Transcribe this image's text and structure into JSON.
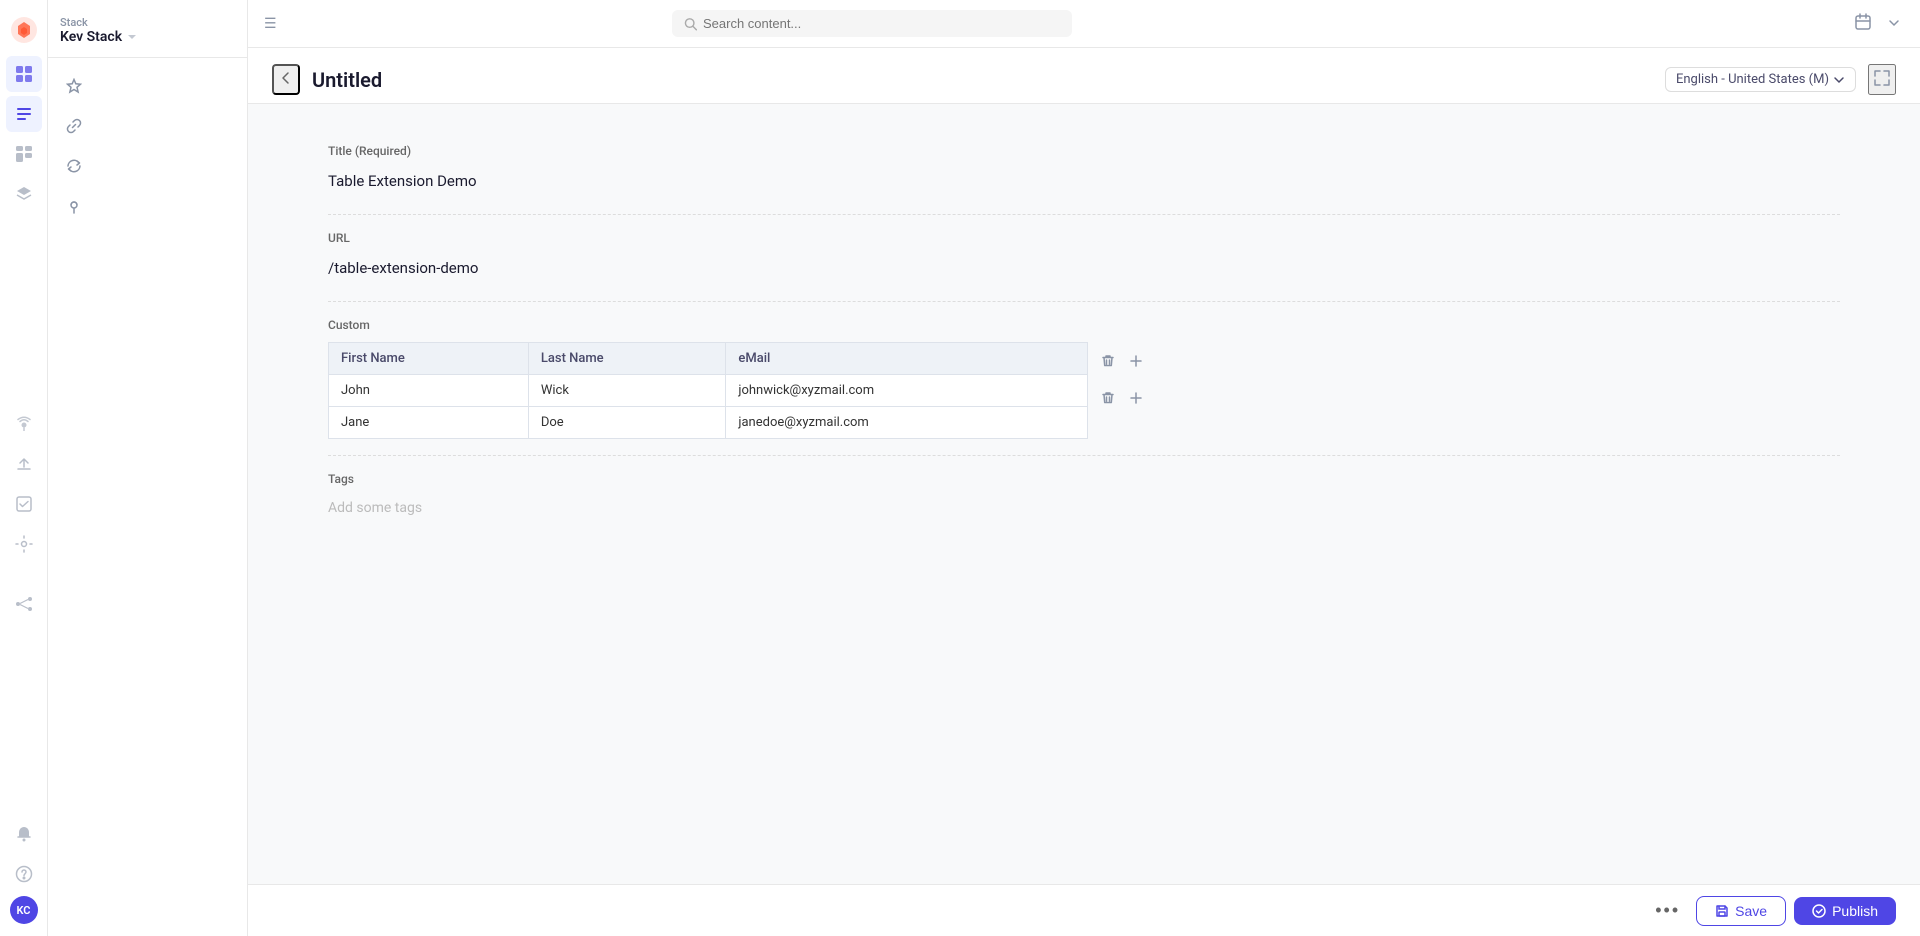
{
  "app": {
    "brand": "Stack",
    "workspace": "Kev Stack"
  },
  "topbar": {
    "search_placeholder": "Search content..."
  },
  "editor": {
    "title": "Untitled",
    "back_label": "←",
    "locale": "English - United States (M)",
    "fullscreen_label": "⛶"
  },
  "form": {
    "title_label": "Title (Required)",
    "title_value": "Table Extension Demo",
    "url_label": "URL",
    "url_value": "/table-extension-demo",
    "custom_label": "Custom",
    "tags_label": "Tags",
    "tags_placeholder": "Add some tags"
  },
  "table": {
    "headers": [
      "First Name",
      "Last Name",
      "eMail"
    ],
    "rows": [
      [
        "John",
        "Wick",
        "johnwick@xyzmail.com"
      ],
      [
        "Jane",
        "Doe",
        "janedoe@xyzmail.com"
      ]
    ]
  },
  "footer": {
    "more_label": "•••",
    "save_label": "Save",
    "publish_label": "Publish"
  },
  "nav": {
    "items": [
      {
        "name": "dashboard",
        "icon": "⊞"
      },
      {
        "name": "content",
        "icon": "≡"
      },
      {
        "name": "blocks",
        "icon": "⊡"
      },
      {
        "name": "layers",
        "icon": "⊕"
      }
    ],
    "bottom": [
      {
        "name": "bell",
        "icon": "🔔"
      },
      {
        "name": "help",
        "icon": "?"
      }
    ],
    "avatar_initials": "KC"
  },
  "sidebar": {
    "icons": [
      "★",
      "🔗",
      "↺",
      "📍"
    ]
  },
  "colors": {
    "accent": "#4f46e5",
    "accent_light": "#eef2ff"
  }
}
